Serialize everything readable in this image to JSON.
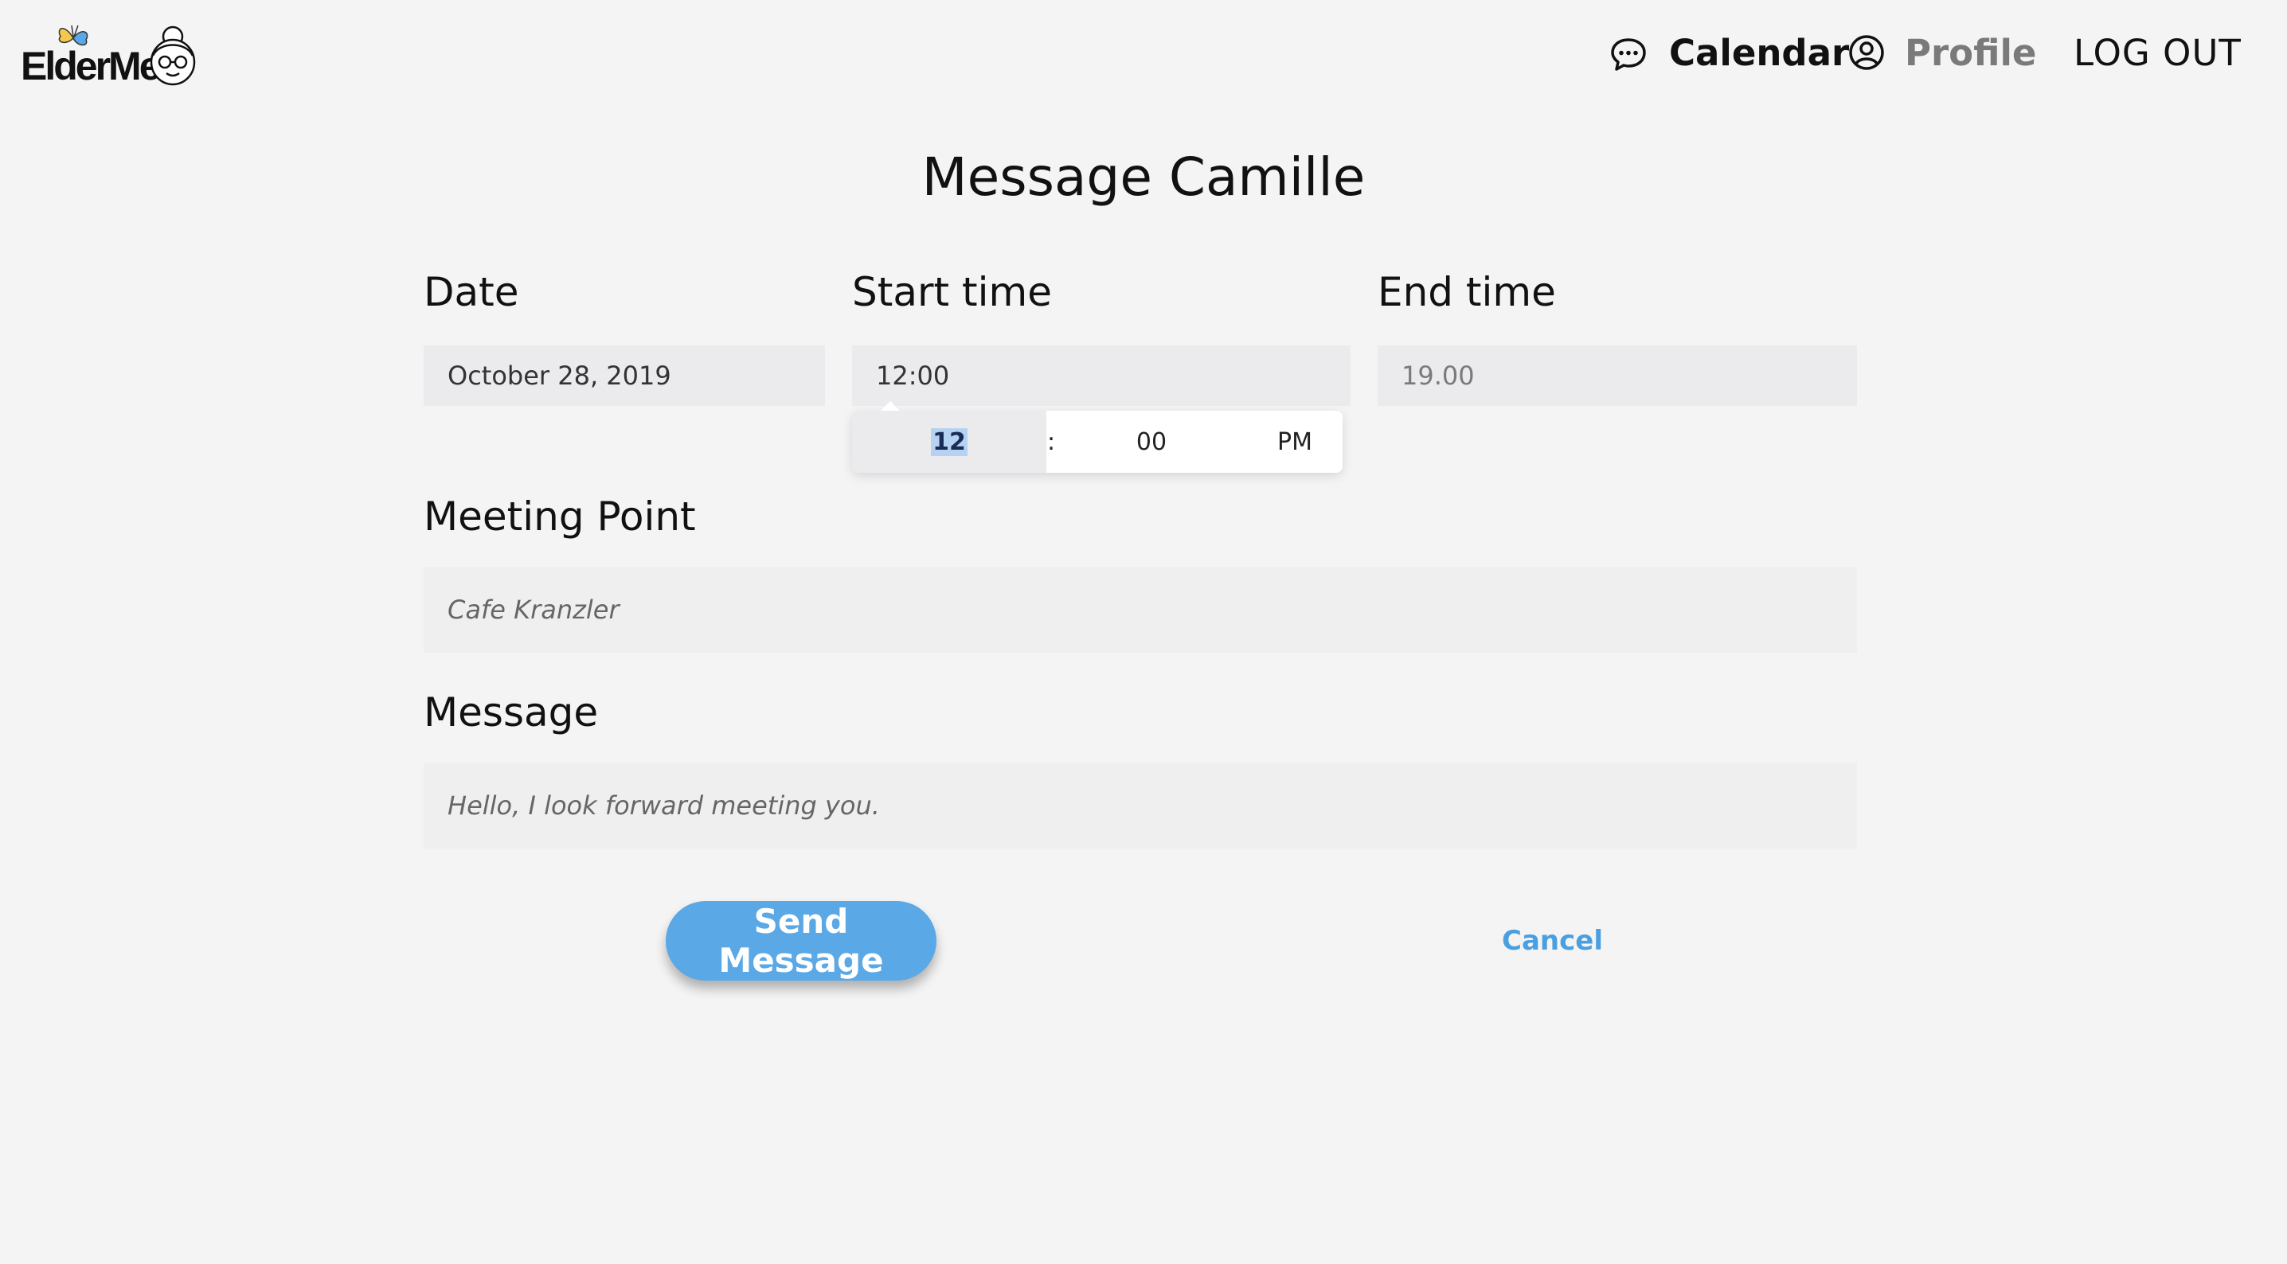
{
  "header": {
    "logo_text": "ElderMe",
    "nav": {
      "calendar_label": "Calendar",
      "profile_label": "Profile",
      "logout_label": "LOG OUT"
    }
  },
  "title": "Message Camille",
  "form": {
    "date": {
      "label": "Date",
      "value": "October 28, 2019"
    },
    "start_time": {
      "label": "Start time",
      "value": "12:00",
      "picker": {
        "hour": "12",
        "separator": ":",
        "minute": "00",
        "period": "PM"
      }
    },
    "end_time": {
      "label": "End time",
      "placeholder": "19.00"
    },
    "meeting_point": {
      "label": "Meeting Point",
      "placeholder": "Cafe Kranzler"
    },
    "message": {
      "label": "Message",
      "placeholder": "Hello, I look forward meeting you."
    }
  },
  "actions": {
    "send_label": "Send Message",
    "cancel_label": "Cancel"
  },
  "colors": {
    "background": "#f4f4f4",
    "field_bg": "#ebebed",
    "accent": "#5ba8e6",
    "link": "#4a9fe0",
    "hour_highlight": "#b5d2f3"
  },
  "icons": [
    "chat-bubble-icon",
    "user-circle-icon",
    "butterfly-icon",
    "grandma-face-icon"
  ]
}
